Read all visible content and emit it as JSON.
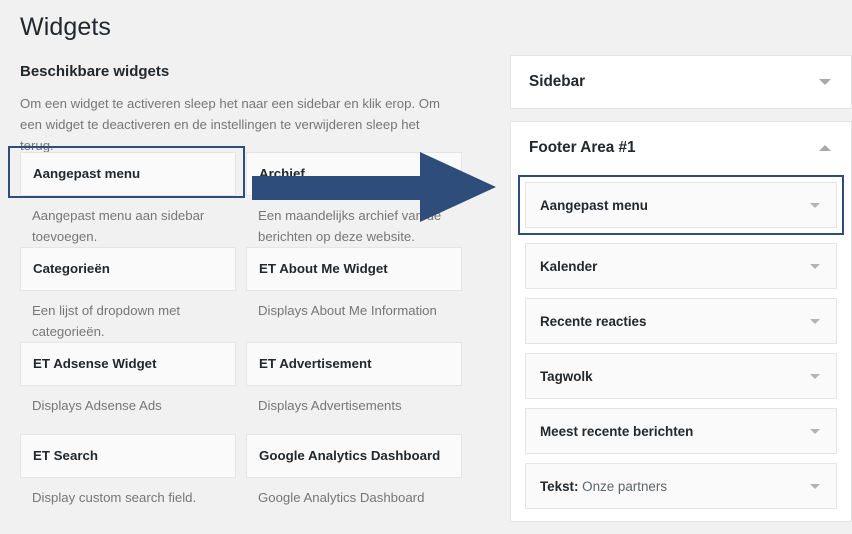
{
  "page": {
    "title": "Widgets"
  },
  "available": {
    "heading": "Beschikbare widgets",
    "description": "Om een widget te activeren sleep het naar een sidebar en klik erop. Om een widget te deactiveren en de instellingen te verwijderen sleep het terug.",
    "widgets": [
      {
        "title": "Aangepast menu",
        "desc": "Aangepast menu aan sidebar toevoegen.",
        "highlighted": true
      },
      {
        "title": "Archief",
        "desc": "Een maandelijks archief van de berichten op deze website.",
        "highlighted": false
      },
      {
        "title": "Categorieën",
        "desc": "Een lijst of dropdown met categorieën.",
        "highlighted": false
      },
      {
        "title": "ET About Me Widget",
        "desc": "Displays About Me Information",
        "highlighted": false
      },
      {
        "title": "ET Adsense Widget",
        "desc": "Displays Adsense Ads",
        "highlighted": false
      },
      {
        "title": "ET Advertisement",
        "desc": "Displays Advertisements",
        "highlighted": false
      },
      {
        "title": "ET Search",
        "desc": "Display custom search field.",
        "highlighted": false
      },
      {
        "title": "Google Analytics Dashboard",
        "desc": "Google Analytics Dashboard",
        "highlighted": false
      }
    ]
  },
  "sidebars": [
    {
      "name": "Sidebar",
      "state": "collapsed",
      "toggle_icon": "chevron-down-icon",
      "widgets": []
    },
    {
      "name": "Footer Area #1",
      "state": "expanded",
      "toggle_icon": "chevron-up-icon",
      "widgets": [
        {
          "title": "Aangepast menu",
          "suffix": "",
          "toggle_icon": "chevron-down-icon",
          "highlighted": true
        },
        {
          "title": "Kalender",
          "suffix": "",
          "toggle_icon": "chevron-down-icon",
          "highlighted": false
        },
        {
          "title": "Recente reacties",
          "suffix": "",
          "toggle_icon": "chevron-down-icon",
          "highlighted": false
        },
        {
          "title": "Tagwolk",
          "suffix": "",
          "toggle_icon": "chevron-down-icon",
          "highlighted": false
        },
        {
          "title": "Meest recente berichten",
          "suffix": "",
          "toggle_icon": "chevron-down-icon",
          "highlighted": false
        },
        {
          "title": "Tekst:",
          "suffix": " Onze partners",
          "toggle_icon": "chevron-down-icon",
          "highlighted": false
        }
      ]
    }
  ],
  "annotation": {
    "type": "arrow-right",
    "color": "#2f4d7a",
    "description": "drag arrow from Archief area toward Footer Area widget list"
  },
  "colors": {
    "background": "#f1f1f1",
    "panel": "#ffffff",
    "widget_box": "#fafafa",
    "border": "#e5e5e5",
    "accent": "#2f4d7a",
    "text": "#23282d",
    "muted": "#767676"
  }
}
